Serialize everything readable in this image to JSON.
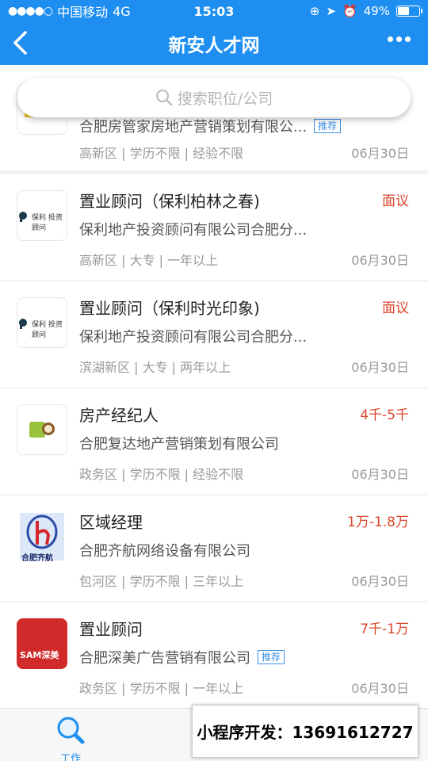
{
  "status_bar": {
    "carrier": "中国移动",
    "network": "4G",
    "time": "15:03",
    "battery": "49%",
    "battery_level": 0.49
  },
  "header": {
    "title": "新安人才网"
  },
  "search": {
    "placeholder": "搜索职位/公司"
  },
  "colors": {
    "primary": "#1e8ff0",
    "salary": "#d9472b",
    "tag": "#3b8ee8"
  },
  "jobs": [
    {
      "title": "",
      "salary": "",
      "company": "合肥房管家房地产营销策划有限公...",
      "tag": "推荐",
      "meta": "高新区 | 学历不限 | 经验不限",
      "date": "06月30日",
      "logo_icon": "lft-logo"
    },
    {
      "title": "置业顾问（保利柏林之春)",
      "salary": "面议",
      "company": "保利地产投资顾问有限公司合肥分...",
      "tag": "",
      "meta": "高新区 | 大专 | 一年以上",
      "date": "06月30日",
      "logo_icon": "poly-logo",
      "logo_text": "保利 投资顾问"
    },
    {
      "title": "置业顾问（保利时光印象)",
      "salary": "面议",
      "company": "保利地产投资顾问有限公司合肥分...",
      "tag": "",
      "meta": "滨湖新区 | 大专 | 两年以上",
      "date": "06月30日",
      "logo_icon": "poly-logo",
      "logo_text": "保利 投资顾问"
    },
    {
      "title": "房产经纪人",
      "salary": "4千-5千",
      "company": "合肥复达地产营销策划有限公司",
      "tag": "",
      "meta": "政务区 | 学历不限 | 经验不限",
      "date": "06月30日",
      "logo_icon": "fuda-logo"
    },
    {
      "title": "区域经理",
      "salary": "1万-1.8万",
      "company": "合肥齐航网络设备有限公司",
      "tag": "",
      "meta": "包河区 | 学历不限 | 三年以上",
      "date": "06月30日",
      "logo_icon": "qihang-logo",
      "logo_text": "合肥齐航"
    },
    {
      "title": "置业顾问",
      "salary": "7千-1万",
      "company": "合肥深美广告营销有限公司",
      "tag": "推荐",
      "meta": "政务区 | 学历不限 | 一年以上",
      "date": "06月30日",
      "logo_icon": "sam-logo",
      "logo_text": "SAM深美"
    }
  ],
  "tabbar": {
    "work_label": "工作"
  },
  "promo": {
    "text": "小程序开发：13691612727"
  }
}
